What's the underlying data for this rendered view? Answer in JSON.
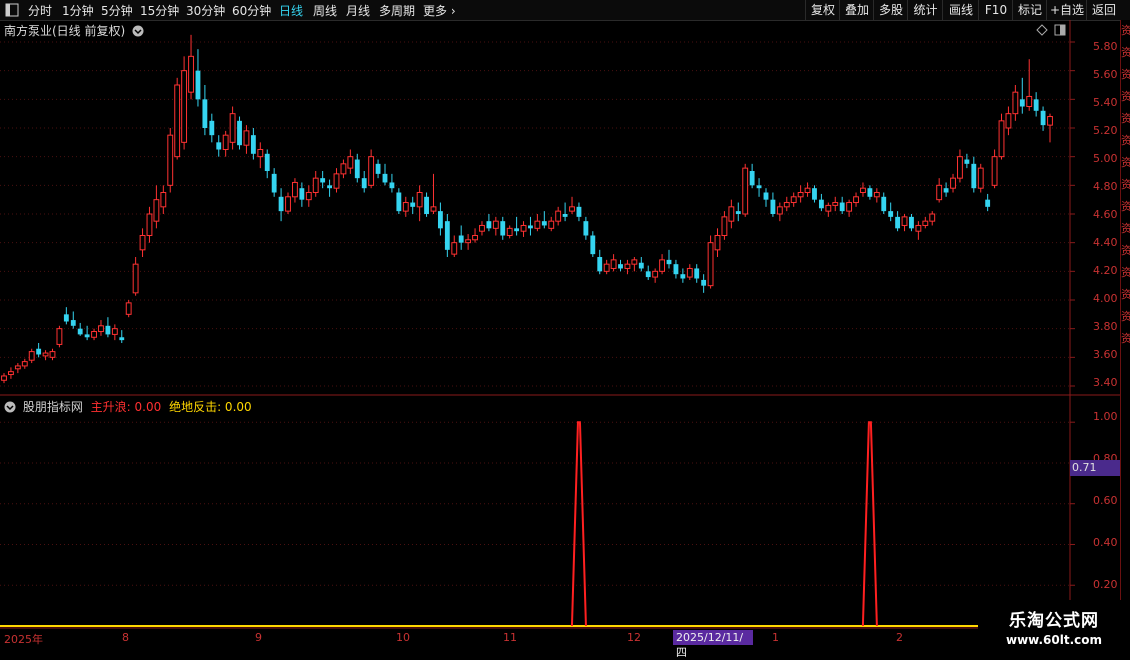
{
  "toolbar": {
    "periods": [
      "分时",
      "1分钟",
      "5分钟",
      "15分钟",
      "30分钟",
      "60分钟",
      "日线",
      "周线",
      "月线",
      "多周期",
      "更多"
    ],
    "active": "日线",
    "right": [
      "复权",
      "叠加",
      "多股",
      "统计",
      "画线",
      "F10",
      "标记",
      "+自选",
      "返回"
    ]
  },
  "main_chart": {
    "title": "南方泵业(日线 前复权)",
    "y_ticks": [
      "5.80",
      "5.60",
      "5.40",
      "5.20",
      "5.00",
      "4.80",
      "4.60",
      "4.40",
      "4.20",
      "4.00",
      "3.80",
      "3.60",
      "3.40"
    ]
  },
  "sub_chart": {
    "name": "股朋指标网",
    "label1": "主升浪: 0.00",
    "label2": "绝地反击: 0.00",
    "y_ticks": [
      "1.00",
      "0.80",
      "0.60",
      "0.40",
      "0.20"
    ],
    "current_value": "0.71"
  },
  "x_axis": {
    "labels": [
      "2025年",
      "8",
      "9",
      "10",
      "11",
      "12",
      "1",
      "2"
    ],
    "crosshair_date": "2025/12/11/四"
  },
  "watermark": {
    "line1": "乐淘公式网",
    "line2": "www.60lt.com"
  },
  "right_strip": "资资资资资资资资资资资资资资资",
  "chart_data": [
    {
      "type": "candlestick",
      "title": "南方泵业(日线 前复权)",
      "ylim": [
        3.4,
        5.8
      ],
      "up_color": "#ff3232",
      "down_color": "#35d4f0",
      "ohlc": [
        [
          3.44,
          3.49,
          3.42,
          3.47
        ],
        [
          3.48,
          3.53,
          3.45,
          3.5
        ],
        [
          3.52,
          3.56,
          3.49,
          3.54
        ],
        [
          3.54,
          3.59,
          3.52,
          3.57
        ],
        [
          3.58,
          3.66,
          3.56,
          3.64
        ],
        [
          3.66,
          3.7,
          3.6,
          3.62
        ],
        [
          3.61,
          3.65,
          3.58,
          3.63
        ],
        [
          3.6,
          3.66,
          3.58,
          3.64
        ],
        [
          3.69,
          3.82,
          3.67,
          3.8
        ],
        [
          3.9,
          3.95,
          3.83,
          3.85
        ],
        [
          3.86,
          3.92,
          3.8,
          3.82
        ],
        [
          3.8,
          3.84,
          3.75,
          3.76
        ],
        [
          3.76,
          3.82,
          3.72,
          3.74
        ],
        [
          3.74,
          3.8,
          3.72,
          3.78
        ],
        [
          3.78,
          3.86,
          3.75,
          3.82
        ],
        [
          3.82,
          3.88,
          3.74,
          3.76
        ],
        [
          3.76,
          3.83,
          3.72,
          3.8
        ],
        [
          3.74,
          3.79,
          3.7,
          3.72
        ],
        [
          3.9,
          4.0,
          3.88,
          3.98
        ],
        [
          4.05,
          4.3,
          4.03,
          4.25
        ],
        [
          4.35,
          4.5,
          4.3,
          4.45
        ],
        [
          4.45,
          4.65,
          4.4,
          4.6
        ],
        [
          4.55,
          4.8,
          4.5,
          4.7
        ],
        [
          4.65,
          4.8,
          4.6,
          4.75
        ],
        [
          4.8,
          5.2,
          4.75,
          5.15
        ],
        [
          5.0,
          5.55,
          4.98,
          5.5
        ],
        [
          5.1,
          5.7,
          5.05,
          5.6
        ],
        [
          5.45,
          5.85,
          5.4,
          5.7
        ],
        [
          5.6,
          5.75,
          5.35,
          5.4
        ],
        [
          5.4,
          5.5,
          5.15,
          5.2
        ],
        [
          5.25,
          5.3,
          5.1,
          5.15
        ],
        [
          5.1,
          5.15,
          5.0,
          5.05
        ],
        [
          5.05,
          5.18,
          5.0,
          5.15
        ],
        [
          5.1,
          5.35,
          5.05,
          5.3
        ],
        [
          5.25,
          5.28,
          5.05,
          5.08
        ],
        [
          5.08,
          5.22,
          5.02,
          5.18
        ],
        [
          5.15,
          5.2,
          4.98,
          5.02
        ],
        [
          5.0,
          5.1,
          4.92,
          5.05
        ],
        [
          5.02,
          5.05,
          4.85,
          4.9
        ],
        [
          4.88,
          4.92,
          4.72,
          4.75
        ],
        [
          4.72,
          4.78,
          4.55,
          4.62
        ],
        [
          4.62,
          4.75,
          4.6,
          4.72
        ],
        [
          4.72,
          4.85,
          4.68,
          4.82
        ],
        [
          4.78,
          4.82,
          4.65,
          4.7
        ],
        [
          4.7,
          4.8,
          4.65,
          4.75
        ],
        [
          4.75,
          4.9,
          4.72,
          4.85
        ],
        [
          4.85,
          4.9,
          4.78,
          4.82
        ],
        [
          4.8,
          4.84,
          4.72,
          4.78
        ],
        [
          4.78,
          4.92,
          4.75,
          4.88
        ],
        [
          4.88,
          4.98,
          4.85,
          4.95
        ],
        [
          4.92,
          5.05,
          4.88,
          5.0
        ],
        [
          4.98,
          5.02,
          4.82,
          4.85
        ],
        [
          4.85,
          4.9,
          4.75,
          4.78
        ],
        [
          4.8,
          5.05,
          4.78,
          5.0
        ],
        [
          4.95,
          4.98,
          4.85,
          4.88
        ],
        [
          4.88,
          4.95,
          4.8,
          4.82
        ],
        [
          4.82,
          4.88,
          4.75,
          4.78
        ],
        [
          4.75,
          4.78,
          4.6,
          4.62
        ],
        [
          4.62,
          4.72,
          4.58,
          4.68
        ],
        [
          4.68,
          4.72,
          4.6,
          4.65
        ],
        [
          4.65,
          4.8,
          4.55,
          4.75
        ],
        [
          4.72,
          4.75,
          4.58,
          4.6
        ],
        [
          4.62,
          4.88,
          4.6,
          4.65
        ],
        [
          4.62,
          4.68,
          4.45,
          4.5
        ],
        [
          4.55,
          4.6,
          4.3,
          4.35
        ],
        [
          4.32,
          4.45,
          4.3,
          4.4
        ],
        [
          4.45,
          4.52,
          4.35,
          4.4
        ],
        [
          4.4,
          4.46,
          4.35,
          4.42
        ],
        [
          4.42,
          4.5,
          4.4,
          4.45
        ],
        [
          4.48,
          4.55,
          4.45,
          4.52
        ],
        [
          4.55,
          4.6,
          4.48,
          4.5
        ],
        [
          4.5,
          4.58,
          4.45,
          4.55
        ],
        [
          4.55,
          4.58,
          4.42,
          4.45
        ],
        [
          4.45,
          4.52,
          4.43,
          4.5
        ],
        [
          4.5,
          4.58,
          4.45,
          4.48
        ],
        [
          4.48,
          4.55,
          4.44,
          4.52
        ],
        [
          4.52,
          4.58,
          4.45,
          4.5
        ],
        [
          4.5,
          4.6,
          4.48,
          4.55
        ],
        [
          4.55,
          4.62,
          4.5,
          4.52
        ],
        [
          4.5,
          4.58,
          4.48,
          4.55
        ],
        [
          4.55,
          4.65,
          4.52,
          4.62
        ],
        [
          4.6,
          4.68,
          4.55,
          4.58
        ],
        [
          4.62,
          4.72,
          4.6,
          4.65
        ],
        [
          4.65,
          4.68,
          4.55,
          4.58
        ],
        [
          4.55,
          4.58,
          4.42,
          4.45
        ],
        [
          4.45,
          4.48,
          4.3,
          4.32
        ],
        [
          4.3,
          4.35,
          4.18,
          4.2
        ],
        [
          4.2,
          4.28,
          4.18,
          4.25
        ],
        [
          4.22,
          4.32,
          4.2,
          4.28
        ],
        [
          4.25,
          4.28,
          4.2,
          4.22
        ],
        [
          4.22,
          4.28,
          4.18,
          4.25
        ],
        [
          4.25,
          4.3,
          4.2,
          4.28
        ],
        [
          4.26,
          4.3,
          4.2,
          4.22
        ],
        [
          4.2,
          4.24,
          4.14,
          4.16
        ],
        [
          4.16,
          4.22,
          4.12,
          4.2
        ],
        [
          4.2,
          4.32,
          4.18,
          4.28
        ],
        [
          4.28,
          4.35,
          4.22,
          4.25
        ],
        [
          4.25,
          4.28,
          4.15,
          4.18
        ],
        [
          4.18,
          4.22,
          4.12,
          4.15
        ],
        [
          4.16,
          4.25,
          4.14,
          4.22
        ],
        [
          4.22,
          4.25,
          4.12,
          4.15
        ],
        [
          4.14,
          4.18,
          4.05,
          4.1
        ],
        [
          4.1,
          4.45,
          4.08,
          4.4
        ],
        [
          4.35,
          4.5,
          4.3,
          4.45
        ],
        [
          4.45,
          4.62,
          4.42,
          4.58
        ],
        [
          4.55,
          4.7,
          4.5,
          4.65
        ],
        [
          4.62,
          4.68,
          4.55,
          4.6
        ],
        [
          4.6,
          4.95,
          4.58,
          4.92
        ],
        [
          4.9,
          4.95,
          4.78,
          4.8
        ],
        [
          4.8,
          4.85,
          4.72,
          4.78
        ],
        [
          4.75,
          4.78,
          4.65,
          4.7
        ],
        [
          4.7,
          4.75,
          4.58,
          4.6
        ],
        [
          4.6,
          4.68,
          4.55,
          4.65
        ],
        [
          4.65,
          4.72,
          4.62,
          4.68
        ],
        [
          4.68,
          4.75,
          4.65,
          4.72
        ],
        [
          4.72,
          4.8,
          4.68,
          4.75
        ],
        [
          4.75,
          4.82,
          4.72,
          4.78
        ],
        [
          4.78,
          4.8,
          4.68,
          4.7
        ],
        [
          4.7,
          4.74,
          4.62,
          4.64
        ],
        [
          4.62,
          4.68,
          4.58,
          4.66
        ],
        [
          4.66,
          4.72,
          4.62,
          4.68
        ],
        [
          4.68,
          4.72,
          4.6,
          4.62
        ],
        [
          4.62,
          4.7,
          4.58,
          4.68
        ],
        [
          4.68,
          4.75,
          4.65,
          4.72
        ],
        [
          4.75,
          4.82,
          4.72,
          4.78
        ],
        [
          4.78,
          4.8,
          4.7,
          4.72
        ],
        [
          4.72,
          4.78,
          4.68,
          4.75
        ],
        [
          4.72,
          4.75,
          4.6,
          4.62
        ],
        [
          4.62,
          4.68,
          4.55,
          4.58
        ],
        [
          4.58,
          4.62,
          4.48,
          4.5
        ],
        [
          4.52,
          4.6,
          4.48,
          4.58
        ],
        [
          4.58,
          4.6,
          4.48,
          4.5
        ],
        [
          4.48,
          4.55,
          4.42,
          4.52
        ],
        [
          4.52,
          4.58,
          4.5,
          4.55
        ],
        [
          4.55,
          4.62,
          4.52,
          4.6
        ],
        [
          4.7,
          4.85,
          4.68,
          4.8
        ],
        [
          4.78,
          4.82,
          4.72,
          4.75
        ],
        [
          4.78,
          4.88,
          4.75,
          4.85
        ],
        [
          4.85,
          5.05,
          4.82,
          5.0
        ],
        [
          4.98,
          5.02,
          4.92,
          4.95
        ],
        [
          4.95,
          5.0,
          4.75,
          4.78
        ],
        [
          4.78,
          4.95,
          4.75,
          4.92
        ],
        [
          4.7,
          4.74,
          4.62,
          4.65
        ],
        [
          4.8,
          5.05,
          4.78,
          5.0
        ],
        [
          5.0,
          5.3,
          4.98,
          5.25
        ],
        [
          5.2,
          5.35,
          5.15,
          5.3
        ],
        [
          5.3,
          5.5,
          5.25,
          5.45
        ],
        [
          5.4,
          5.55,
          5.3,
          5.35
        ],
        [
          5.35,
          5.68,
          5.32,
          5.42
        ],
        [
          5.4,
          5.45,
          5.28,
          5.32
        ],
        [
          5.32,
          5.35,
          5.18,
          5.22
        ],
        [
          5.22,
          5.3,
          5.1,
          5.28
        ]
      ]
    },
    {
      "type": "line",
      "series": [
        {
          "name": "主升浪",
          "color": "#ff2020",
          "spikes_at": [
            83,
            125
          ],
          "value": 1.0
        },
        {
          "name": "绝地反击",
          "color": "#ffd700",
          "value": 0.0
        }
      ],
      "ylim": [
        0,
        1.05
      ]
    }
  ]
}
